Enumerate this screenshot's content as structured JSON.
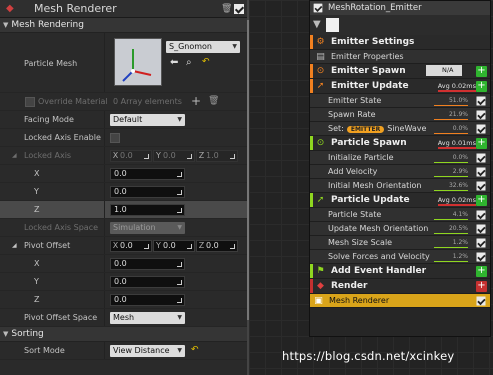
{
  "left": {
    "title": "Mesh Renderer",
    "section_mesh_rendering": "Mesh Rendering",
    "particle_mesh_label": "Particle Mesh",
    "particle_mesh_value": "S_Gnomon",
    "override_material_label": "Override Material",
    "array_elements": "0 Array elements",
    "facing_mode_label": "Facing Mode",
    "facing_mode_value": "Default",
    "locked_axis_enable_label": "Locked Axis Enable",
    "locked_axis_label": "Locked Axis",
    "locked_axis": {
      "x": "0.0",
      "y": "0.0",
      "z": "1.0"
    },
    "x_label": "X",
    "y_label": "Y",
    "z_label": "Z",
    "locked_axis_x": "0.0",
    "locked_axis_y": "0.0",
    "locked_axis_z": "1.0",
    "locked_axis_space_label": "Locked Axis Space",
    "locked_axis_space_value": "Simulation",
    "pivot_offset_label": "Pivot Offset",
    "pivot_offset": {
      "x": "0.0",
      "y": "0.0",
      "z": "0.0"
    },
    "pivot_x": "0.0",
    "pivot_y": "0.0",
    "pivot_z": "0.0",
    "pivot_offset_space_label": "Pivot Offset Space",
    "pivot_offset_space_value": "Mesh",
    "section_sorting": "Sorting",
    "sort_mode_label": "Sort Mode",
    "sort_mode_value": "View Distance"
  },
  "emitter": {
    "name": "MeshRotation_Emitter",
    "rows": {
      "settings": "Emitter Settings",
      "properties": "Emitter Properties",
      "spawn": "Emitter Spawn",
      "spawn_na": "N/A",
      "update": "Emitter Update",
      "update_avg": "Avg 0.02ms",
      "state": "Emitter State",
      "state_pct": "51.0%",
      "spawn_rate": "Spawn Rate",
      "spawn_rate_pct": "21.9%",
      "set_prefix": "Set:",
      "set_tag": "EMITTER",
      "set_value": "SineWave",
      "set_pct": "0.0%",
      "particle_spawn": "Particle Spawn",
      "particle_spawn_avg": "Avg 0.01ms",
      "init_particle": "Initialize Particle",
      "init_particle_pct": "0.0%",
      "add_velocity": "Add Velocity",
      "add_velocity_pct": "2.9%",
      "init_mesh_orient": "Initial Mesh Orientation",
      "init_mesh_orient_pct": "32.6%",
      "particle_update": "Particle Update",
      "particle_update_avg": "Avg 0.02ms",
      "particle_state": "Particle State",
      "particle_state_pct": "4.1%",
      "update_mesh_orient": "Update Mesh Orientation",
      "update_mesh_orient_pct": "20.5%",
      "mesh_size_scale": "Mesh Size Scale",
      "mesh_size_scale_pct": "1.2%",
      "solve_forces": "Solve Forces and Velocity",
      "solve_forces_pct": "1.2%",
      "add_event_handler": "Add Event Handler",
      "render": "Render",
      "mesh_renderer": "Mesh Renderer"
    }
  },
  "watermark": "https://blog.csdn.net/xcinkey",
  "colors": {
    "spawn_accent": "#f08020",
    "update_accent": "#f08020",
    "particle_spawn_accent": "#8fd620",
    "particle_update_accent": "#8fd620",
    "selected_row": "#d9a41a",
    "add_button": "#2fb52f",
    "remove_button": "#c43030"
  }
}
